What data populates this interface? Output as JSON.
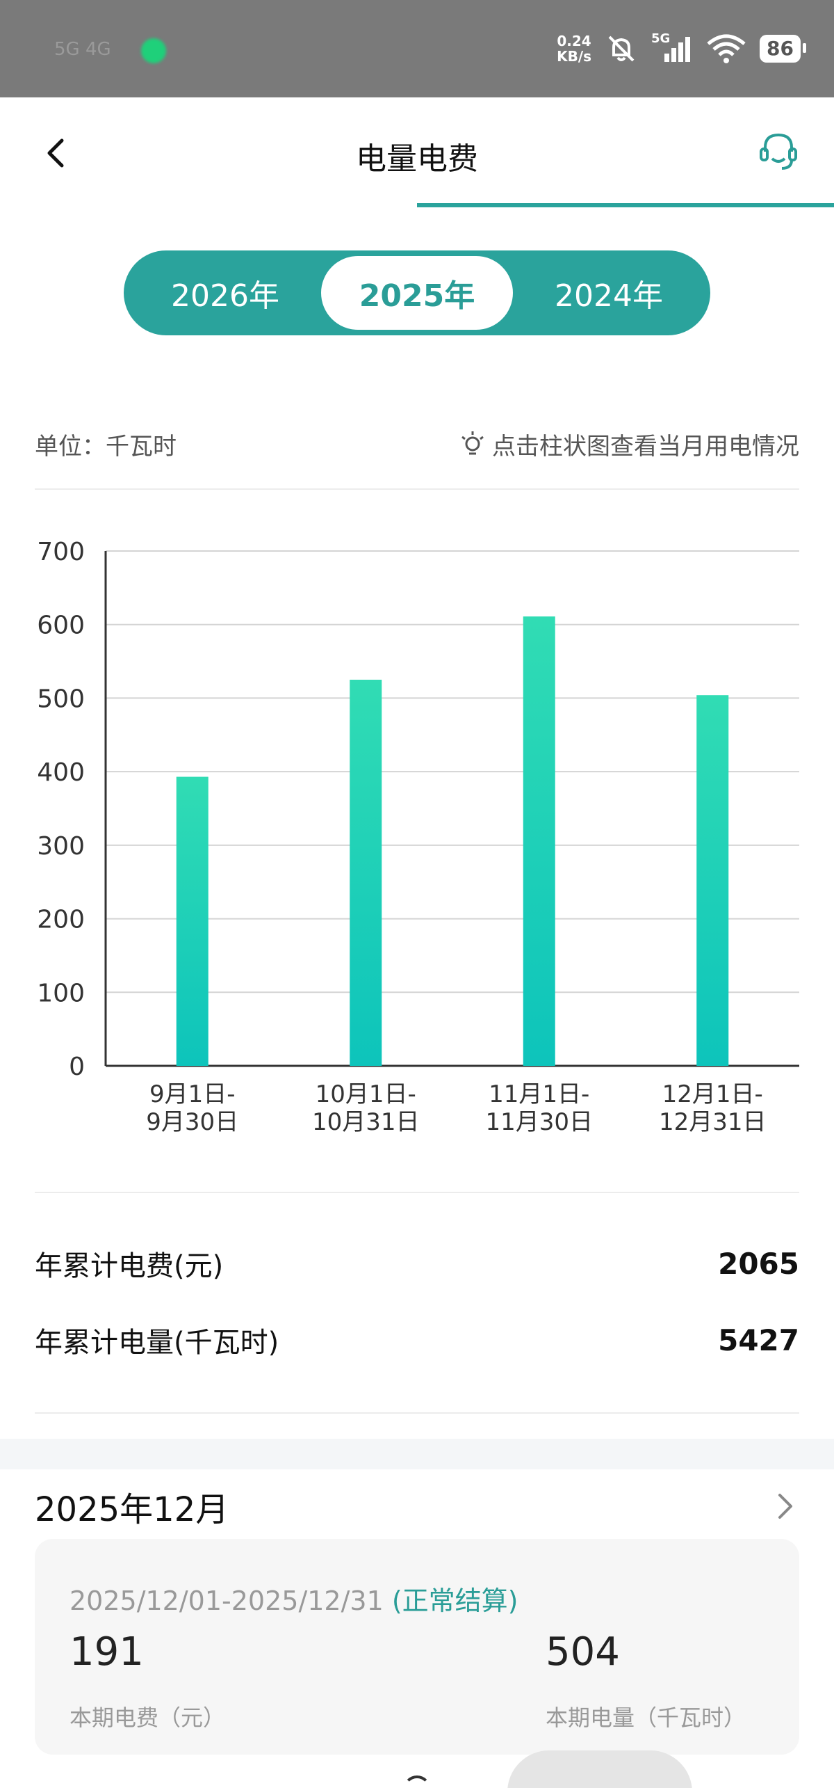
{
  "status_bar": {
    "carrier_blur": "5G 4G",
    "speed_value": "0.24",
    "speed_unit": "KB/s",
    "network": "5G",
    "battery": "86"
  },
  "header": {
    "title": "电量电费"
  },
  "year_tabs": [
    {
      "label": "2026年",
      "active": false
    },
    {
      "label": "2025年",
      "active": true
    },
    {
      "label": "2024年",
      "active": false
    }
  ],
  "unit_row": {
    "unit_label": "单位：千瓦时",
    "tip": "点击柱状图查看当月用电情况"
  },
  "chart_data": {
    "type": "bar",
    "categories": [
      [
        "9月1日-",
        "9月30日"
      ],
      [
        "10月1日-",
        "10月31日"
      ],
      [
        "11月1日-",
        "11月30日"
      ],
      [
        "12月1日-",
        "12月31日"
      ]
    ],
    "values": [
      393,
      525,
      611,
      504
    ],
    "ylim": [
      0,
      700
    ],
    "yticks": [
      0,
      100,
      200,
      300,
      400,
      500,
      600,
      700
    ],
    "grid": true,
    "bar_color_top": "#31dcb4",
    "bar_color_bottom": "#0dc4bb"
  },
  "totals": {
    "fee_label": "年累计电费(元)",
    "fee_value": "2065",
    "energy_label": "年累计电量(千瓦时)",
    "energy_value": "5427"
  },
  "month_section": {
    "title": "2025年12月",
    "period": "2025/12/01-2025/12/31",
    "status": "(正常结算)",
    "fee_value": "191",
    "fee_label": "本期电费（元）",
    "energy_value": "504",
    "energy_label": "本期电量（千瓦时）"
  },
  "colors": {
    "accent": "#2aa39c",
    "accent_text": "#2a9d97"
  }
}
